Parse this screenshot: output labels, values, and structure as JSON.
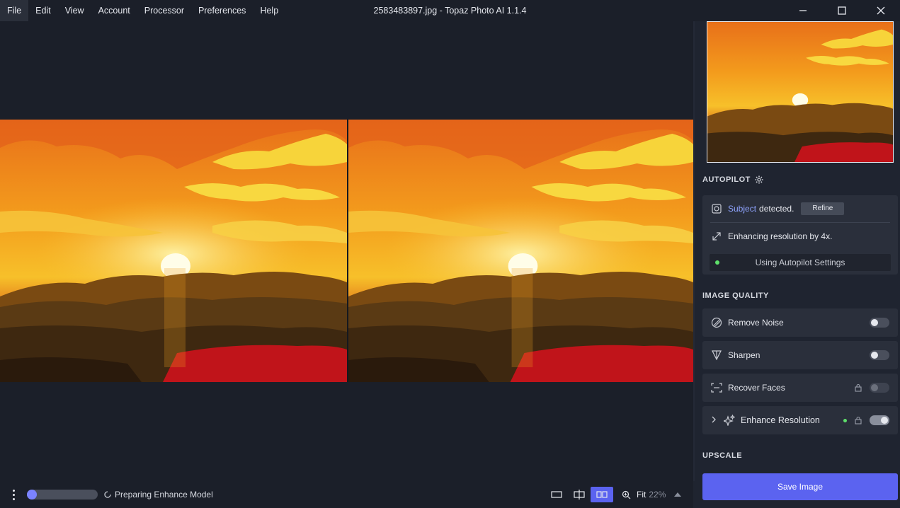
{
  "menu": [
    "File",
    "Edit",
    "View",
    "Account",
    "Processor",
    "Preferences",
    "Help"
  ],
  "window_title": "2583483897.jpg - Topaz Photo AI 1.1.4",
  "autopilot": {
    "title": "AUTOPILOT",
    "subject_link": "Subject",
    "detected_text": "detected.",
    "refine_label": "Refine",
    "enhancing_text": "Enhancing resolution by 4x.",
    "settings_label": "Using Autopilot Settings"
  },
  "image_quality": {
    "title": "IMAGE QUALITY",
    "items": [
      {
        "label": "Remove Noise",
        "enabled": false
      },
      {
        "label": "Sharpen",
        "enabled": false
      },
      {
        "label": "Recover Faces",
        "enabled": false,
        "locked": true
      },
      {
        "label": "Enhance Resolution",
        "enabled": true,
        "locked": true
      }
    ]
  },
  "upscale": {
    "title": "UPSCALE"
  },
  "save_label": "Save Image",
  "status": {
    "text": "Preparing Enhance Model",
    "progress": 0.05
  },
  "zoom": {
    "fit_label": "Fit",
    "percent": "22%"
  },
  "colors": {
    "accent": "#5b63f0",
    "ready_dot": "#5ee06b",
    "link": "#8fa4ff"
  }
}
